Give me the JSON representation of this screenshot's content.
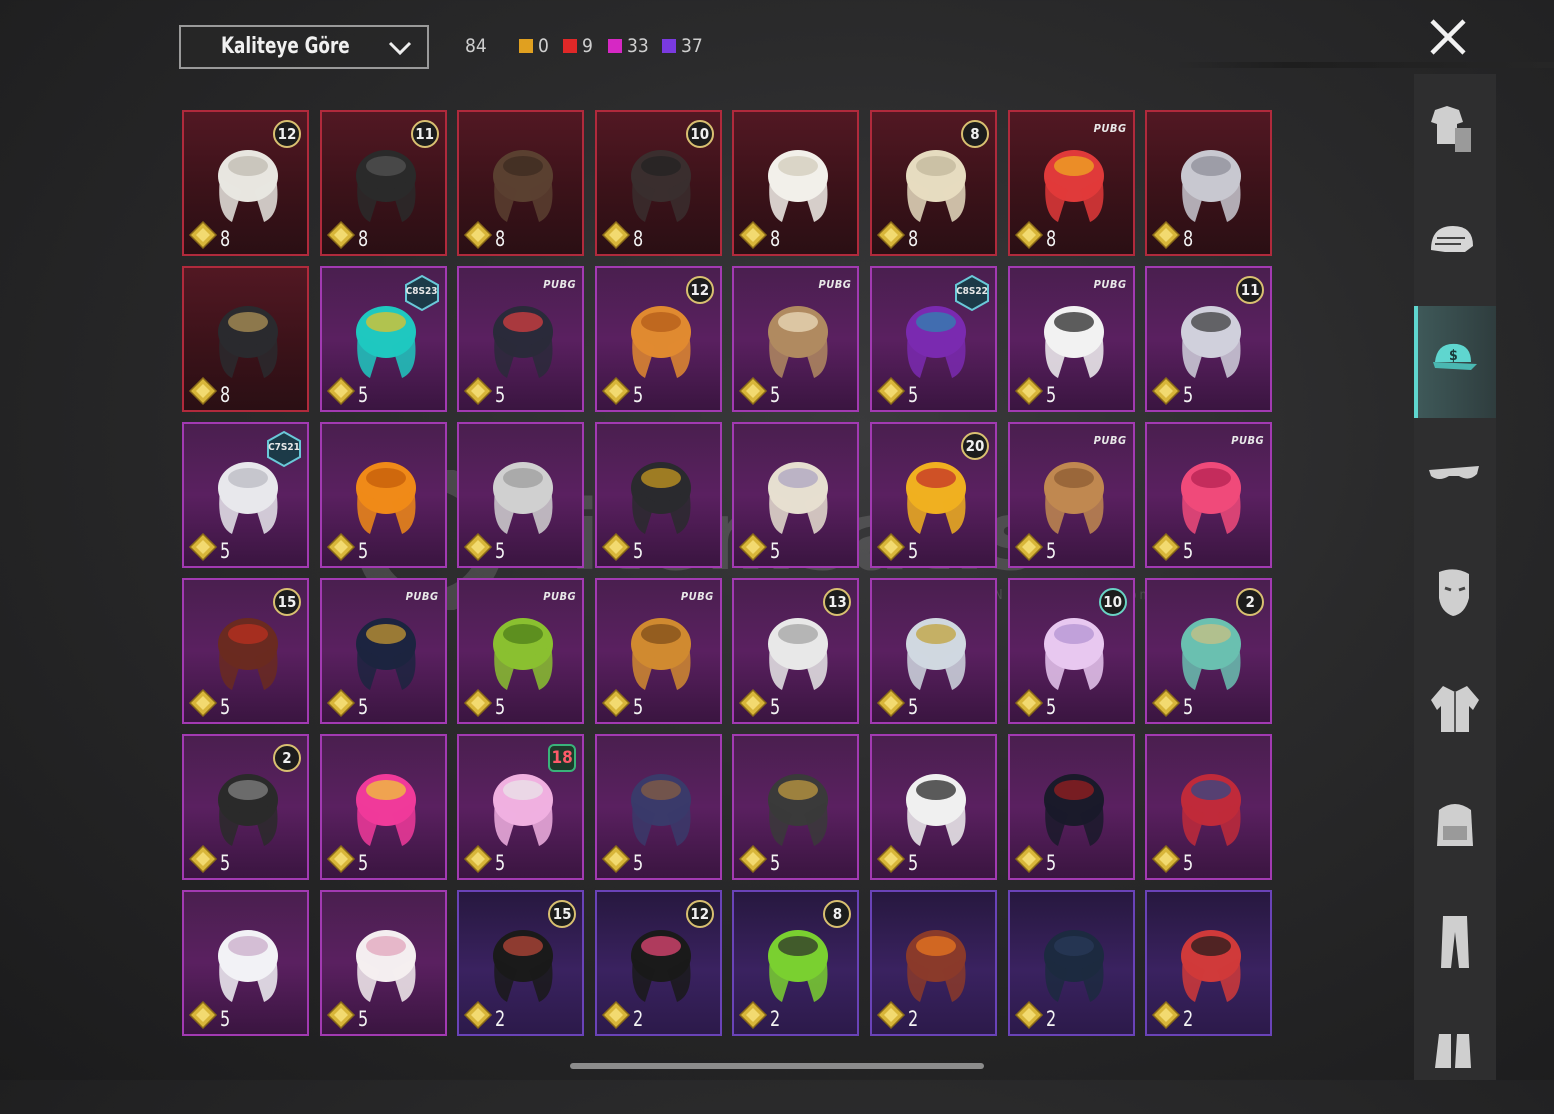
{
  "sort": {
    "label": "Kaliteye Göre"
  },
  "counts": {
    "total": "84",
    "quality": [
      {
        "color": "#e0a020",
        "value": "0"
      },
      {
        "color": "#e02828",
        "value": "9"
      },
      {
        "color": "#d628c4",
        "value": "33"
      },
      {
        "color": "#7a3adf",
        "value": "37"
      }
    ]
  },
  "watermark": {
    "text": "itemsatis",
    "sub": "HESAP / SKIN / ITEM / ... .com"
  },
  "sidebar": {
    "items": [
      {
        "name": "outfit-category",
        "icon": "outfit-icon",
        "active": false
      },
      {
        "name": "helmet-category",
        "icon": "helmet-icon",
        "active": false
      },
      {
        "name": "hat-category",
        "icon": "cap-icon",
        "active": true
      },
      {
        "name": "glasses-category",
        "icon": "glasses-icon",
        "active": false
      },
      {
        "name": "mask-category",
        "icon": "mask-icon",
        "active": false
      },
      {
        "name": "jacket-category",
        "icon": "jacket-icon",
        "active": false
      },
      {
        "name": "backpack-category",
        "icon": "backpack-icon",
        "active": false
      },
      {
        "name": "pants-category",
        "icon": "pants-icon",
        "active": false
      },
      {
        "name": "boots-category",
        "icon": "boots-icon",
        "active": false
      }
    ]
  },
  "items": [
    {
      "count": "8",
      "frame": "red",
      "badge": "12",
      "art": "white-hair"
    },
    {
      "count": "8",
      "frame": "red",
      "badge": "11",
      "art": "black-hair"
    },
    {
      "count": "8",
      "frame": "red",
      "badge": "",
      "art": "brown-hair"
    },
    {
      "count": "8",
      "frame": "red",
      "badge": "10",
      "art": "dark-hair"
    },
    {
      "count": "8",
      "frame": "red",
      "badge": "",
      "art": "white-cowboy-hat"
    },
    {
      "count": "8",
      "frame": "red",
      "badge": "8",
      "art": "blonde-hair"
    },
    {
      "count": "8",
      "frame": "red",
      "tag": "PUBG",
      "art": "mecha-helmet"
    },
    {
      "count": "8",
      "frame": "red",
      "badge": "",
      "art": "silver-hair"
    },
    {
      "count": "8",
      "frame": "red",
      "badge": "",
      "art": "tricorn-hat"
    },
    {
      "count": "5",
      "frame": "mag",
      "hex": "C8S23",
      "art": "cat-headphones"
    },
    {
      "count": "5",
      "frame": "mag",
      "tag": "PUBG",
      "art": "cap-goggles"
    },
    {
      "count": "5",
      "frame": "mag",
      "badge": "12",
      "art": "orange-hair"
    },
    {
      "count": "5",
      "frame": "mag",
      "tag": "PUBG",
      "art": "llama-mask"
    },
    {
      "count": "5",
      "frame": "mag",
      "hex": "C8S22",
      "art": "purple-hair"
    },
    {
      "count": "5",
      "frame": "mag",
      "tag": "PUBG",
      "art": "panda-mask"
    },
    {
      "count": "5",
      "frame": "mag",
      "badge": "11",
      "art": "flower-hair"
    },
    {
      "count": "5",
      "frame": "mag",
      "hex": "C7S21",
      "art": "white-fluff"
    },
    {
      "count": "5",
      "frame": "mag",
      "badge": "",
      "art": "pumpkin"
    },
    {
      "count": "5",
      "frame": "mag",
      "badge": "",
      "art": "grey-beret"
    },
    {
      "count": "5",
      "frame": "mag",
      "badge": "",
      "art": "dual-caps"
    },
    {
      "count": "5",
      "frame": "mag",
      "badge": "",
      "art": "braided-hair"
    },
    {
      "count": "5",
      "frame": "mag",
      "badge": "20",
      "art": "monkey-king"
    },
    {
      "count": "5",
      "frame": "mag",
      "tag": "PUBG",
      "art": "bald-cap"
    },
    {
      "count": "5",
      "frame": "mag",
      "tag": "PUBG",
      "art": "pink-hair"
    },
    {
      "count": "5",
      "frame": "mag",
      "badge": "15",
      "art": "horned-helm"
    },
    {
      "count": "5",
      "frame": "mag",
      "tag": "PUBG",
      "art": "ninja-helm"
    },
    {
      "count": "5",
      "frame": "mag",
      "tag": "PUBG",
      "art": "octopus"
    },
    {
      "count": "5",
      "frame": "mag",
      "tag": "PUBG",
      "art": "cobra"
    },
    {
      "count": "5",
      "frame": "mag",
      "badge": "13",
      "art": "robot-helm"
    },
    {
      "count": "5",
      "frame": "mag",
      "badge": "",
      "art": "pharaoh"
    },
    {
      "count": "5",
      "frame": "mag",
      "badge": "10",
      "teal": true,
      "art": "pink-helmet"
    },
    {
      "count": "5",
      "frame": "mag",
      "badge": "2",
      "art": "teal-knight"
    },
    {
      "count": "5",
      "frame": "mag",
      "badge": "2",
      "art": "dread-helm"
    },
    {
      "count": "5",
      "frame": "mag",
      "badge": "",
      "art": "pink-bunny"
    },
    {
      "count": "5",
      "frame": "mag",
      "badge": "18",
      "green": true,
      "art": "spike-cap"
    },
    {
      "count": "5",
      "frame": "mag",
      "badge": "",
      "art": "witch-hat"
    },
    {
      "count": "5",
      "frame": "mag",
      "badge": "",
      "art": "general-helm"
    },
    {
      "count": "5",
      "frame": "mag",
      "badge": "",
      "art": "white-bandana"
    },
    {
      "count": "5",
      "frame": "mag",
      "badge": "",
      "art": "top-hat"
    },
    {
      "count": "5",
      "frame": "mag",
      "badge": "",
      "art": "flower-top-hat"
    },
    {
      "count": "5",
      "frame": "mag",
      "badge": "",
      "art": "sun-hat"
    },
    {
      "count": "5",
      "frame": "mag",
      "badge": "",
      "art": "bunny-ears"
    },
    {
      "count": "2",
      "frame": "pur",
      "badge": "15",
      "art": "pumpkin-beanie"
    },
    {
      "count": "2",
      "frame": "pur",
      "badge": "12",
      "art": "bunny-helm"
    },
    {
      "count": "2",
      "frame": "pur",
      "badge": "8",
      "art": "green-skull"
    },
    {
      "count": "2",
      "frame": "pur",
      "badge": "",
      "art": "goggle-hair"
    },
    {
      "count": "2",
      "frame": "pur",
      "badge": "",
      "art": "navy-beanie"
    },
    {
      "count": "2",
      "frame": "pur",
      "badge": "",
      "art": "football-helmet"
    }
  ]
}
